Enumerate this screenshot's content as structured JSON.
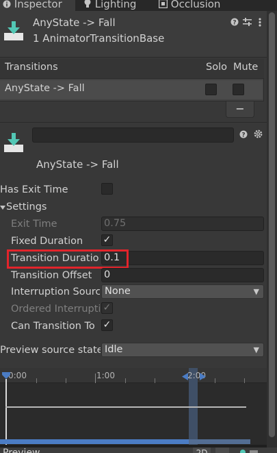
{
  "tabs": [
    {
      "label": "Inspector",
      "icon": "info-icon",
      "active": true
    },
    {
      "label": "Lighting",
      "icon": "bulb-icon",
      "active": false
    },
    {
      "label": "Occlusion",
      "icon": "occlusion-icon",
      "active": false
    }
  ],
  "header": {
    "title": "AnyState -> Fall",
    "subtitle": "1 AnimatorTransitionBase"
  },
  "transitions": {
    "headers": {
      "name": "Transitions",
      "solo": "Solo",
      "mute": "Mute"
    },
    "rows": [
      {
        "name": "AnyState -> Fall",
        "solo": false,
        "mute": false
      }
    ],
    "remove_label": "−"
  },
  "transition": {
    "name_value": "",
    "caption": "AnyState -> Fall",
    "has_exit_time": {
      "label": "Has Exit Time",
      "checked": false
    },
    "settings_label": "Settings",
    "fields": {
      "exit_time": {
        "label": "Exit Time",
        "value": "0.75",
        "enabled": false
      },
      "fixed_duration": {
        "label": "Fixed Duration",
        "checked": true
      },
      "transition_duration": {
        "label": "Transition Duratio",
        "value": "0.1"
      },
      "transition_offset": {
        "label": "Transition Offset",
        "value": "0"
      },
      "interruption_source": {
        "label": "Interruption Sourc",
        "value": "None"
      },
      "ordered_interruption": {
        "label": "Ordered Interrupti",
        "checked": true,
        "enabled": false
      },
      "can_transition_to_self": {
        "label": "Can Transition To",
        "checked": true
      }
    },
    "preview_source_state": {
      "label": "Preview source state",
      "value": "Idle"
    }
  },
  "timeline": {
    "ticks": [
      "0:00",
      "1:00",
      "2:00"
    ],
    "playhead_fraction": 0.0
  },
  "preview": {
    "label": "Preview",
    "mode_2d": "2D"
  },
  "colors": {
    "accent_teal": "#53c7b5",
    "highlight_red": "#e3242b",
    "timeline_blue": "#4b7cc4"
  }
}
